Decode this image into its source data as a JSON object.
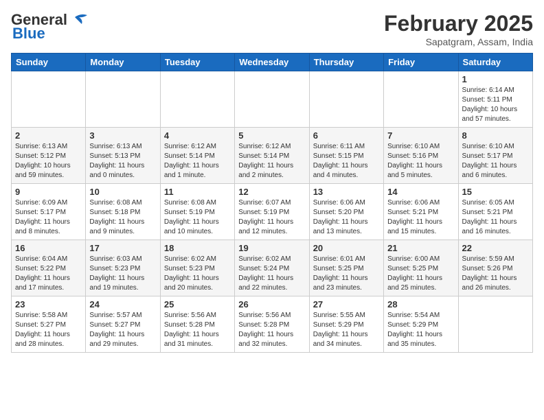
{
  "header": {
    "logo_general": "General",
    "logo_blue": "Blue",
    "month_year": "February 2025",
    "location": "Sapatgram, Assam, India"
  },
  "weekdays": [
    "Sunday",
    "Monday",
    "Tuesday",
    "Wednesday",
    "Thursday",
    "Friday",
    "Saturday"
  ],
  "weeks": [
    [
      {
        "day": "",
        "info": ""
      },
      {
        "day": "",
        "info": ""
      },
      {
        "day": "",
        "info": ""
      },
      {
        "day": "",
        "info": ""
      },
      {
        "day": "",
        "info": ""
      },
      {
        "day": "",
        "info": ""
      },
      {
        "day": "1",
        "info": "Sunrise: 6:14 AM\nSunset: 5:11 PM\nDaylight: 10 hours and 57 minutes."
      }
    ],
    [
      {
        "day": "2",
        "info": "Sunrise: 6:13 AM\nSunset: 5:12 PM\nDaylight: 10 hours and 59 minutes."
      },
      {
        "day": "3",
        "info": "Sunrise: 6:13 AM\nSunset: 5:13 PM\nDaylight: 11 hours and 0 minutes."
      },
      {
        "day": "4",
        "info": "Sunrise: 6:12 AM\nSunset: 5:14 PM\nDaylight: 11 hours and 1 minute."
      },
      {
        "day": "5",
        "info": "Sunrise: 6:12 AM\nSunset: 5:14 PM\nDaylight: 11 hours and 2 minutes."
      },
      {
        "day": "6",
        "info": "Sunrise: 6:11 AM\nSunset: 5:15 PM\nDaylight: 11 hours and 4 minutes."
      },
      {
        "day": "7",
        "info": "Sunrise: 6:10 AM\nSunset: 5:16 PM\nDaylight: 11 hours and 5 minutes."
      },
      {
        "day": "8",
        "info": "Sunrise: 6:10 AM\nSunset: 5:17 PM\nDaylight: 11 hours and 6 minutes."
      }
    ],
    [
      {
        "day": "9",
        "info": "Sunrise: 6:09 AM\nSunset: 5:17 PM\nDaylight: 11 hours and 8 minutes."
      },
      {
        "day": "10",
        "info": "Sunrise: 6:08 AM\nSunset: 5:18 PM\nDaylight: 11 hours and 9 minutes."
      },
      {
        "day": "11",
        "info": "Sunrise: 6:08 AM\nSunset: 5:19 PM\nDaylight: 11 hours and 10 minutes."
      },
      {
        "day": "12",
        "info": "Sunrise: 6:07 AM\nSunset: 5:19 PM\nDaylight: 11 hours and 12 minutes."
      },
      {
        "day": "13",
        "info": "Sunrise: 6:06 AM\nSunset: 5:20 PM\nDaylight: 11 hours and 13 minutes."
      },
      {
        "day": "14",
        "info": "Sunrise: 6:06 AM\nSunset: 5:21 PM\nDaylight: 11 hours and 15 minutes."
      },
      {
        "day": "15",
        "info": "Sunrise: 6:05 AM\nSunset: 5:21 PM\nDaylight: 11 hours and 16 minutes."
      }
    ],
    [
      {
        "day": "16",
        "info": "Sunrise: 6:04 AM\nSunset: 5:22 PM\nDaylight: 11 hours and 17 minutes."
      },
      {
        "day": "17",
        "info": "Sunrise: 6:03 AM\nSunset: 5:23 PM\nDaylight: 11 hours and 19 minutes."
      },
      {
        "day": "18",
        "info": "Sunrise: 6:02 AM\nSunset: 5:23 PM\nDaylight: 11 hours and 20 minutes."
      },
      {
        "day": "19",
        "info": "Sunrise: 6:02 AM\nSunset: 5:24 PM\nDaylight: 11 hours and 22 minutes."
      },
      {
        "day": "20",
        "info": "Sunrise: 6:01 AM\nSunset: 5:25 PM\nDaylight: 11 hours and 23 minutes."
      },
      {
        "day": "21",
        "info": "Sunrise: 6:00 AM\nSunset: 5:25 PM\nDaylight: 11 hours and 25 minutes."
      },
      {
        "day": "22",
        "info": "Sunrise: 5:59 AM\nSunset: 5:26 PM\nDaylight: 11 hours and 26 minutes."
      }
    ],
    [
      {
        "day": "23",
        "info": "Sunrise: 5:58 AM\nSunset: 5:27 PM\nDaylight: 11 hours and 28 minutes."
      },
      {
        "day": "24",
        "info": "Sunrise: 5:57 AM\nSunset: 5:27 PM\nDaylight: 11 hours and 29 minutes."
      },
      {
        "day": "25",
        "info": "Sunrise: 5:56 AM\nSunset: 5:28 PM\nDaylight: 11 hours and 31 minutes."
      },
      {
        "day": "26",
        "info": "Sunrise: 5:56 AM\nSunset: 5:28 PM\nDaylight: 11 hours and 32 minutes."
      },
      {
        "day": "27",
        "info": "Sunrise: 5:55 AM\nSunset: 5:29 PM\nDaylight: 11 hours and 34 minutes."
      },
      {
        "day": "28",
        "info": "Sunrise: 5:54 AM\nSunset: 5:29 PM\nDaylight: 11 hours and 35 minutes."
      },
      {
        "day": "",
        "info": ""
      }
    ]
  ]
}
